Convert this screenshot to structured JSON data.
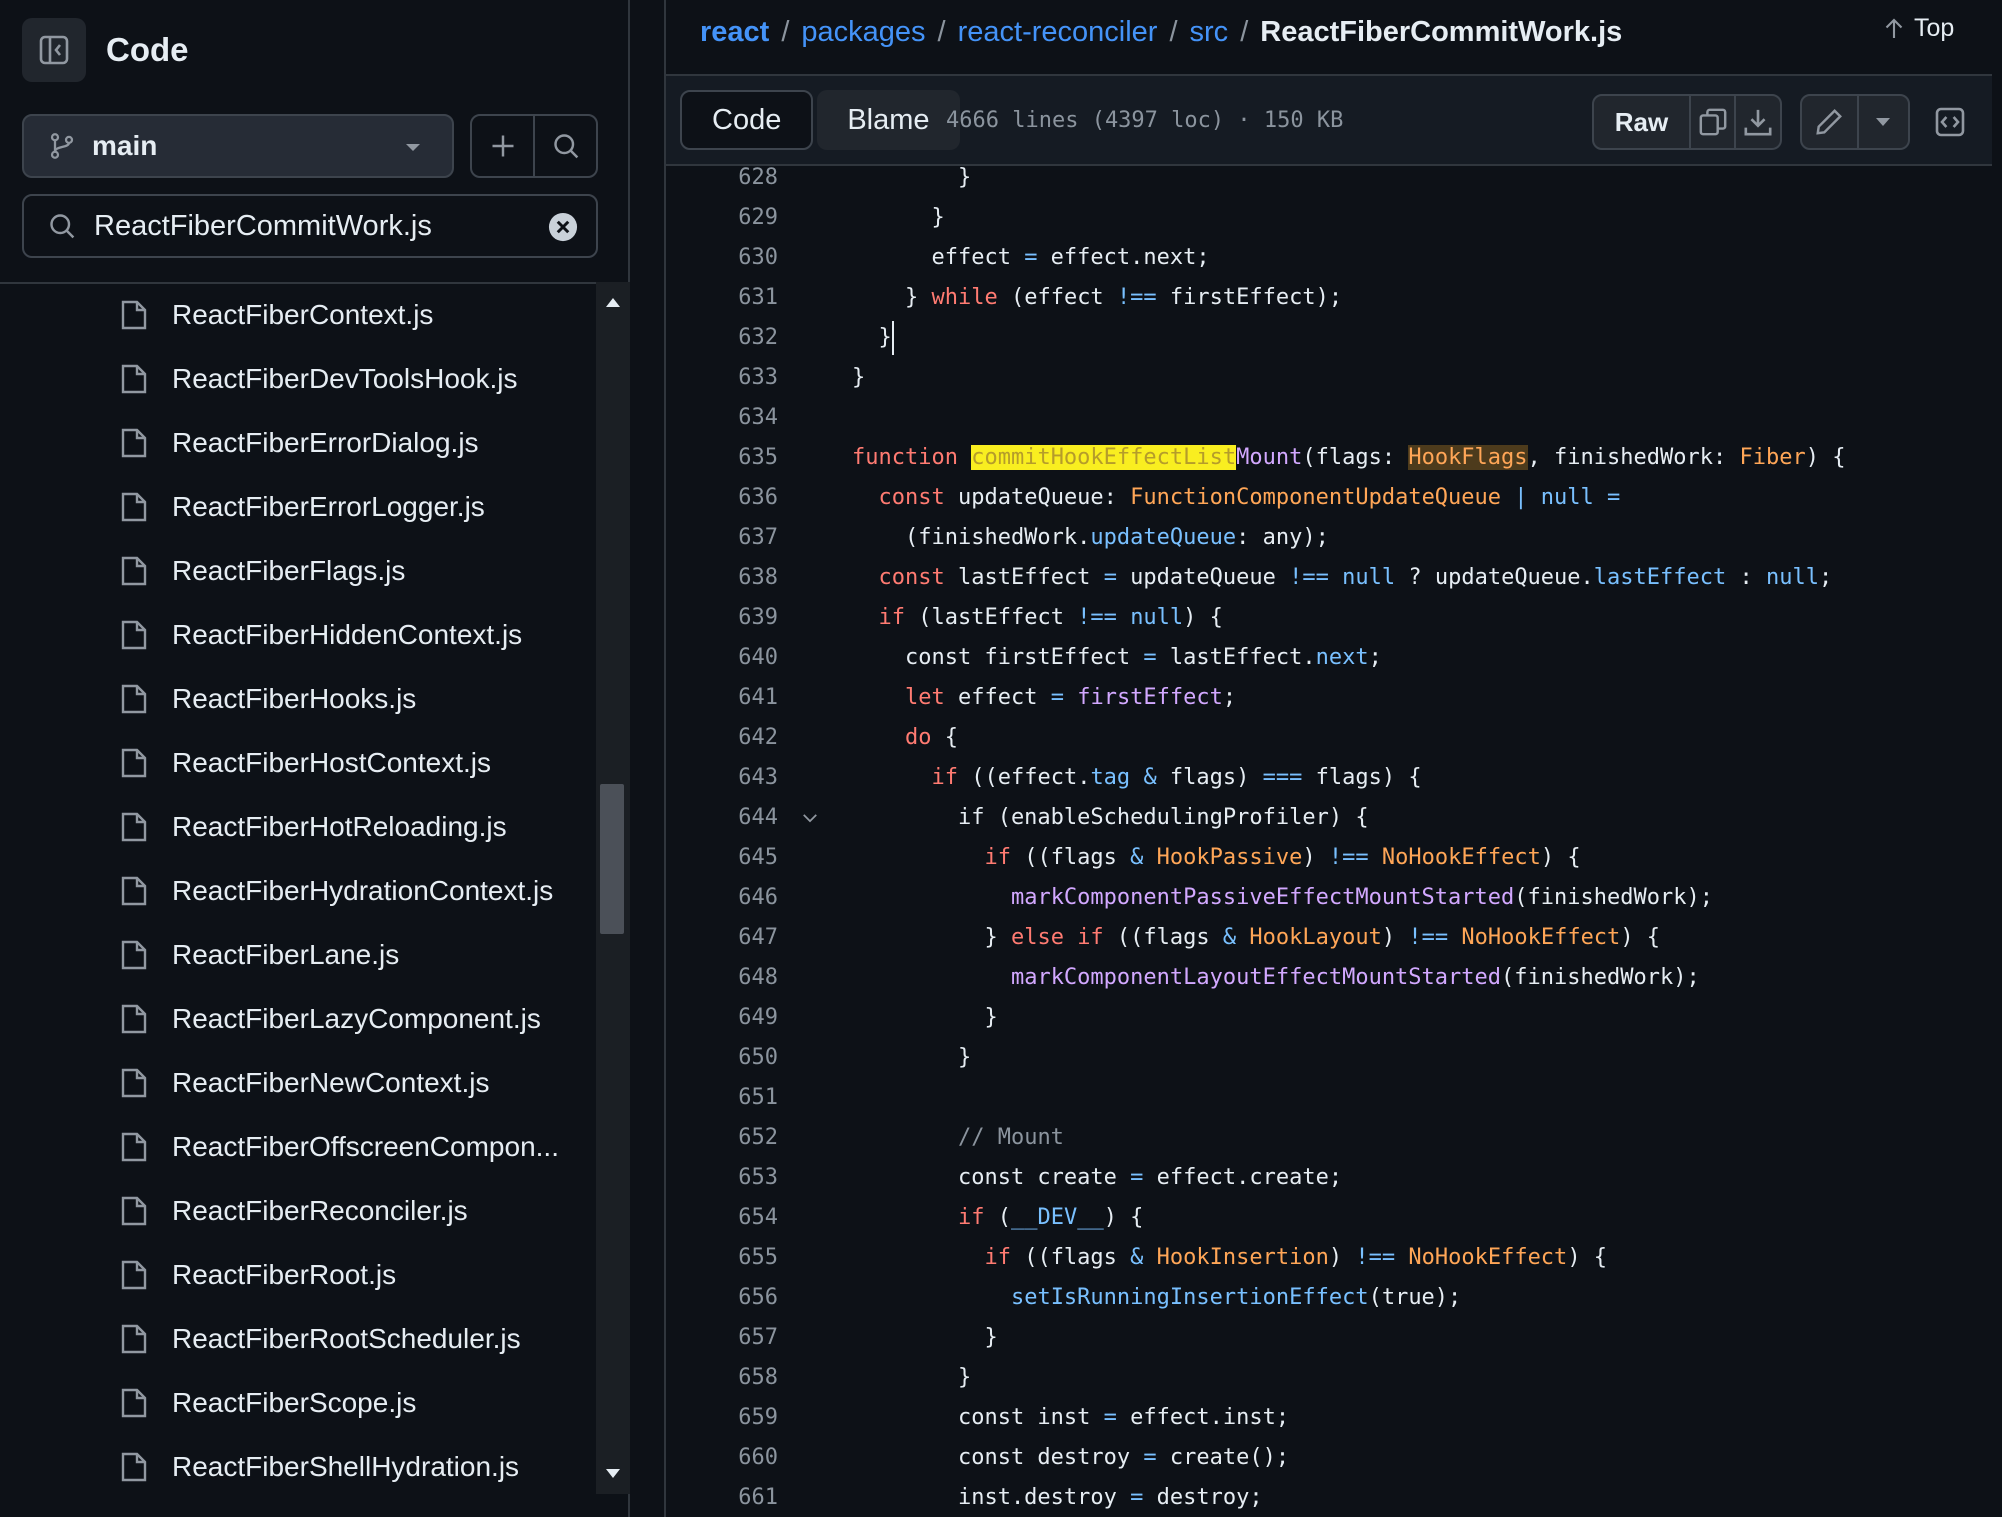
{
  "sidebar": {
    "title": "Code",
    "branch": "main",
    "search_value": "ReactFiberCommitWork.js",
    "files": [
      "ReactFiberContext.js",
      "ReactFiberDevToolsHook.js",
      "ReactFiberErrorDialog.js",
      "ReactFiberErrorLogger.js",
      "ReactFiberFlags.js",
      "ReactFiberHiddenContext.js",
      "ReactFiberHooks.js",
      "ReactFiberHostContext.js",
      "ReactFiberHotReloading.js",
      "ReactFiberHydrationContext.js",
      "ReactFiberLane.js",
      "ReactFiberLazyComponent.js",
      "ReactFiberNewContext.js",
      "ReactFiberOffscreenCompon...",
      "ReactFiberReconciler.js",
      "ReactFiberRoot.js",
      "ReactFiberRootScheduler.js",
      "ReactFiberScope.js",
      "ReactFiberShellHydration.js"
    ]
  },
  "breadcrumb": {
    "repo": "react",
    "parts": [
      "packages",
      "react-reconciler",
      "src"
    ],
    "current": "ReactFiberCommitWork.js"
  },
  "top_link": "Top",
  "toolbar": {
    "code_tab": "Code",
    "blame_tab": "Blame",
    "file_meta": "4666 lines (4397 loc) · 150 KB",
    "raw_label": "Raw"
  },
  "code": {
    "line_numbers": [
      "628",
      "629",
      "630",
      "631",
      "632",
      "633",
      "634",
      "635",
      "636",
      "637",
      "638",
      "639",
      "640",
      "641",
      "642",
      "643",
      "644",
      "645",
      "646",
      "647",
      "648",
      "649",
      "650",
      "651",
      "652",
      "653",
      "654",
      "655",
      "656",
      "657",
      "658",
      "659",
      "660",
      "661"
    ],
    "fold_line": "644"
  }
}
